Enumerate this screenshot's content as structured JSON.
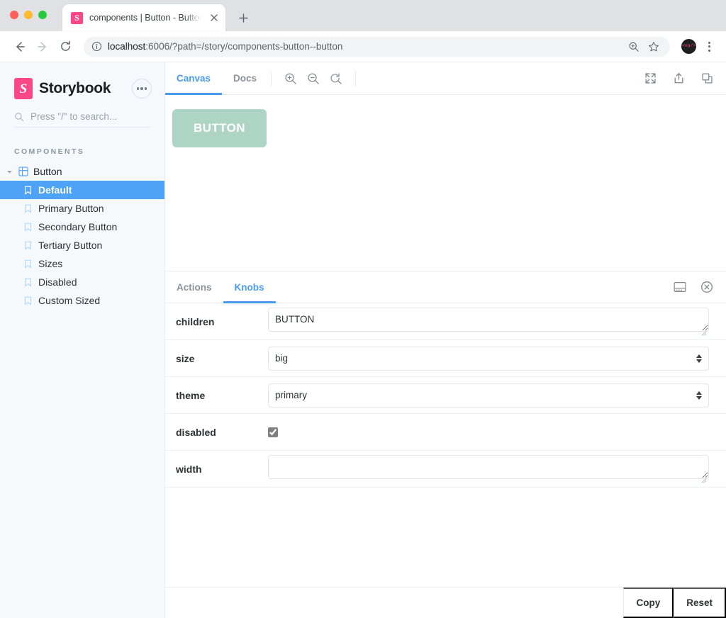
{
  "browser": {
    "tab": {
      "title": "components | Button - Button",
      "favicon_icon": "storybook-favicon",
      "favicon_letter": "S",
      "close_icon": "close-icon"
    },
    "new_tab_label": "+",
    "nav": {
      "back_icon": "arrow-left-icon",
      "forward_icon": "arrow-right-icon",
      "reload_icon": "reload-icon"
    },
    "url": {
      "info_icon": "info-circle-icon",
      "host": "localhost",
      "rest": ":6006/?path=/story/components-button--button",
      "full": "localhost:6006/?path=/story/components-button--button"
    },
    "zoom_icon": "zoom-search-icon",
    "bookmark_icon": "star-icon",
    "avatar_text": "<vp/>",
    "menu_icon": "kebab-menu-icon"
  },
  "sidebar": {
    "brand": {
      "mark_letter": "S",
      "title": "Storybook",
      "mark_color": "#ff4785",
      "menu_icon": "ellipsis-menu-icon"
    },
    "search": {
      "icon": "search-icon",
      "placeholder": "Press \"/\" to search..."
    },
    "section_label": "COMPONENTS",
    "tree": {
      "caret_icon": "chevron-down-icon",
      "component_icon": "grid-component-icon",
      "component_label": "Button"
    },
    "stories": [
      {
        "label": "Default",
        "icon": "bookmark-icon",
        "selected": true
      },
      {
        "label": "Primary Button",
        "icon": "bookmark-icon",
        "selected": false
      },
      {
        "label": "Secondary Button",
        "icon": "bookmark-icon",
        "selected": false
      },
      {
        "label": "Tertiary Button",
        "icon": "bookmark-icon",
        "selected": false
      },
      {
        "label": "Sizes",
        "icon": "bookmark-icon",
        "selected": false
      },
      {
        "label": "Disabled",
        "icon": "bookmark-icon",
        "selected": false
      },
      {
        "label": "Custom Sized",
        "icon": "bookmark-icon",
        "selected": false
      }
    ],
    "selection_color": "#4fa3f7"
  },
  "canvas_toolbar": {
    "tabs": [
      {
        "label": "Canvas",
        "active": true
      },
      {
        "label": "Docs",
        "active": false
      }
    ],
    "zoom_in_icon": "zoom-in-icon",
    "zoom_out_icon": "zoom-out-icon",
    "zoom_reset_icon": "zoom-reset-icon",
    "fullscreen_icon": "fullscreen-expand-icon",
    "share_icon": "share-upload-icon",
    "copy_icon": "copy-duplicate-icon",
    "active_color": "#4a9bf0"
  },
  "preview": {
    "button_label": "BUTTON",
    "button_bg": "#aed4c5",
    "button_text_color": "#ffffff"
  },
  "panel": {
    "tabs": [
      {
        "label": "Actions",
        "active": false
      },
      {
        "label": "Knobs",
        "active": true
      }
    ],
    "layout_icon": "panel-position-icon",
    "close_icon": "close-circle-icon",
    "knobs": [
      {
        "name": "children",
        "type": "textarea",
        "value": "BUTTON",
        "checked": false
      },
      {
        "name": "size",
        "type": "select",
        "value": "big",
        "options": [
          "big"
        ],
        "checked": false
      },
      {
        "name": "theme",
        "type": "select",
        "value": "primary",
        "options": [
          "primary"
        ],
        "checked": false
      },
      {
        "name": "disabled",
        "type": "checkbox",
        "value": "",
        "checked": true
      },
      {
        "name": "width",
        "type": "textarea",
        "value": "",
        "checked": false
      }
    ],
    "footer": {
      "copy_label": "Copy",
      "reset_label": "Reset"
    }
  }
}
